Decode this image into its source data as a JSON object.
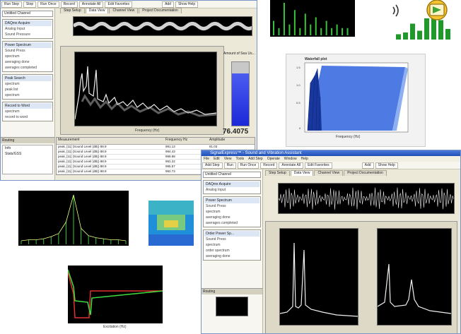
{
  "main_window": {
    "title": "",
    "menu": [],
    "toolbar": [
      {
        "label": "Run Step"
      },
      {
        "label": "Stop"
      },
      {
        "label": "Run Once"
      },
      {
        "label": "Record"
      },
      {
        "label": "Annotate All"
      },
      {
        "label": "Edit Favorites"
      }
    ],
    "tabs": [
      {
        "label": "Step Setup",
        "active": false
      },
      {
        "label": "Data View",
        "active": true
      },
      {
        "label": "Channel View",
        "active": false
      },
      {
        "label": "Project Documentation",
        "active": false
      }
    ],
    "toolbar_right": [
      {
        "label": "Add"
      },
      {
        "label": "Show Help"
      }
    ],
    "device_select": "Untitled Channel",
    "steps": [
      {
        "title": "DAQmx Acquire",
        "items": [
          "Analog Input",
          "Sound Pressure"
        ]
      },
      {
        "title": "Power Spectrum",
        "items": [
          "Sound Press",
          "spectrum",
          "averaging done",
          "averages completed"
        ]
      },
      {
        "title": "Peak Search",
        "items": [
          "spectrum",
          "peak list",
          "spectrum"
        ]
      },
      {
        "title": "Record to Word",
        "items": [
          "spectrum",
          "record to word"
        ]
      }
    ],
    "panel_label": "Routing",
    "panel_items": [
      "Info",
      "Stats/GSS"
    ],
    "meter_title": "Amount of Sea Us...",
    "meter_level": 0.82,
    "meter_value": "76.4075",
    "table_headers": [
      "Measurement",
      "Frequency Hz",
      "Amplitude"
    ],
    "table_rows": [
      [
        "peak, [11] (Sound Level (dB)) 88.9",
        "991.13",
        "81.03"
      ],
      [
        "peak, [11] (Sound Level (dB)) 88.9",
        "994.43",
        "83.41"
      ],
      [
        "peak, [11] (Sound Level (dB)) 88.9",
        "999.98",
        "88.34"
      ],
      [
        "peak, [11] (Sound Level (dB)) 88.9",
        "991.22",
        "85.22"
      ],
      [
        "peak, [11] (Sound Level (dB)) 88.9",
        "995.57",
        "82.19"
      ],
      [
        "peak, [11] (Sound Level (dB)) 88.9",
        "992.73",
        "81.00"
      ]
    ]
  },
  "second_window": {
    "title": "SignalExpress™ - Sound and Vibration Assistant",
    "menu": [
      "File",
      "Edit",
      "View",
      "Tools",
      "Add Step",
      "Operate",
      "Window",
      "Help"
    ],
    "toolbar": [
      {
        "label": "Add Step"
      },
      {
        "label": "Run"
      },
      {
        "label": "Run Once"
      },
      {
        "label": "Record"
      },
      {
        "label": "Annotate All"
      },
      {
        "label": "Edit Favorites"
      }
    ],
    "tabs": [
      {
        "label": "Step Setup",
        "active": false
      },
      {
        "label": "Data View",
        "active": true
      },
      {
        "label": "Channel View",
        "active": false
      },
      {
        "label": "Project Documentation",
        "active": false
      }
    ],
    "toolbar_right": [
      {
        "label": "Add"
      },
      {
        "label": "Show Help"
      }
    ],
    "device_select": "Untitled Channel",
    "steps": [
      {
        "title": "DAQmx Acquire",
        "items": [
          "Analog Input"
        ]
      },
      {
        "title": "Power Spectrum",
        "items": [
          "Sound Press",
          "spectrum",
          "averaging done",
          "averages completed"
        ]
      },
      {
        "title": "Order Power Sp...",
        "items": [
          "Sound Press",
          "spectrum",
          "order spectrum",
          "averaging done"
        ]
      }
    ],
    "panel_label": "Routing"
  },
  "chart_data": [
    {
      "type": "bar",
      "series": [
        {
          "values": [
            4,
            2,
            9,
            3,
            7,
            2,
            6,
            3,
            5,
            2,
            4,
            2,
            3,
            2,
            2
          ]
        }
      ]
    },
    {
      "type": "bar",
      "series": [
        {
          "values": [
            1.5,
            2,
            4.5,
            2.5,
            6,
            8,
            5.5,
            3
          ]
        }
      ]
    },
    {
      "type": "area",
      "title": "Waterfall plot",
      "xlabel": "Frequency (Hz)"
    },
    {
      "type": "line",
      "series": [
        {
          "values": [
            2,
            3,
            3,
            4,
            6,
            9,
            20,
            46,
            14,
            7,
            5,
            4,
            3,
            3,
            2
          ]
        }
      ]
    },
    {
      "type": "heatmap"
    },
    {
      "type": "line",
      "xlabel": "Excitation (Hz)"
    }
  ],
  "colors": {
    "accent_green": "#39c43a",
    "window_blue": "#2b5fc8",
    "waterfall_blue": "#2e5fd0",
    "meter_blue": "#1f2ee0",
    "plot_bg": "#000000"
  },
  "icons": {
    "sound_logo": "speaker-wave-icon",
    "labview_logo": "labview-play-icon"
  }
}
